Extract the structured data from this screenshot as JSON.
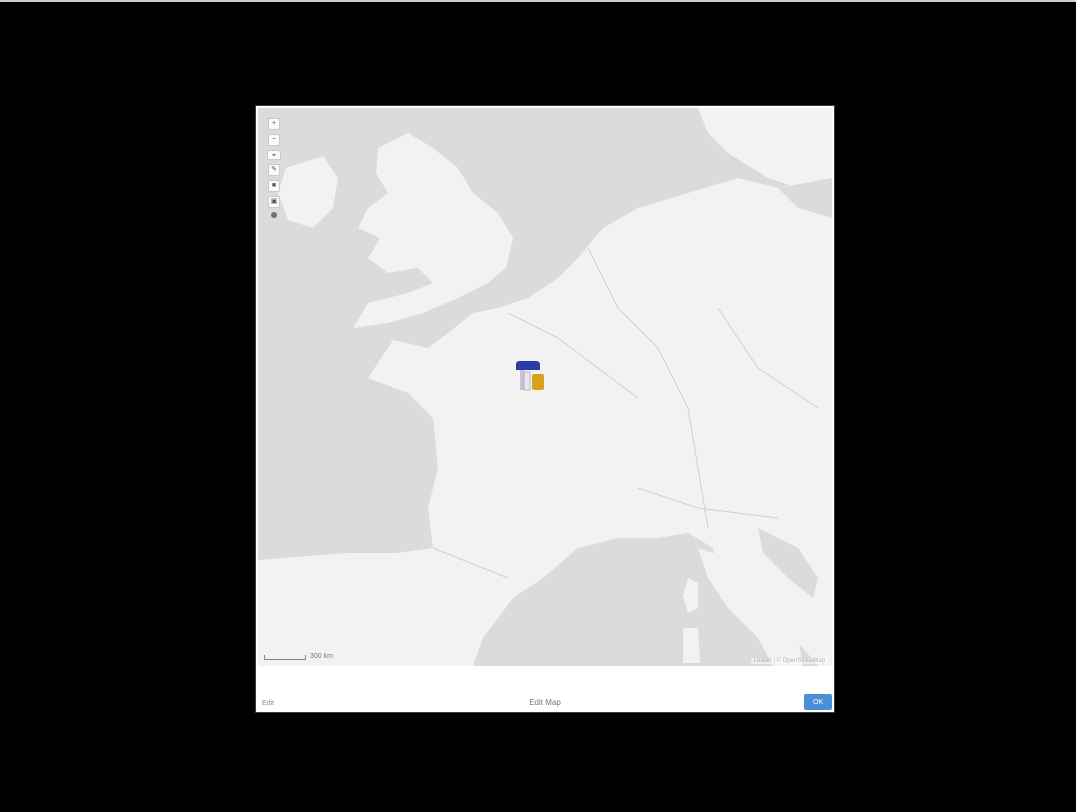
{
  "dialog": {
    "footer_left": "Edit",
    "footer_title": "Edit Map",
    "ok_label": "OK"
  },
  "map": {
    "attribution": "Leaflet | © OpenStreetMap",
    "scale_label": "300 km",
    "tools": [
      "+",
      "−",
      "⌖",
      "✎",
      "■",
      "▣",
      "⬤"
    ],
    "colors": {
      "land": "#f2f2f1",
      "water": "#d9dbdc",
      "marker_blue": "#2e3aa6",
      "marker_gold": "#d9a020"
    }
  }
}
